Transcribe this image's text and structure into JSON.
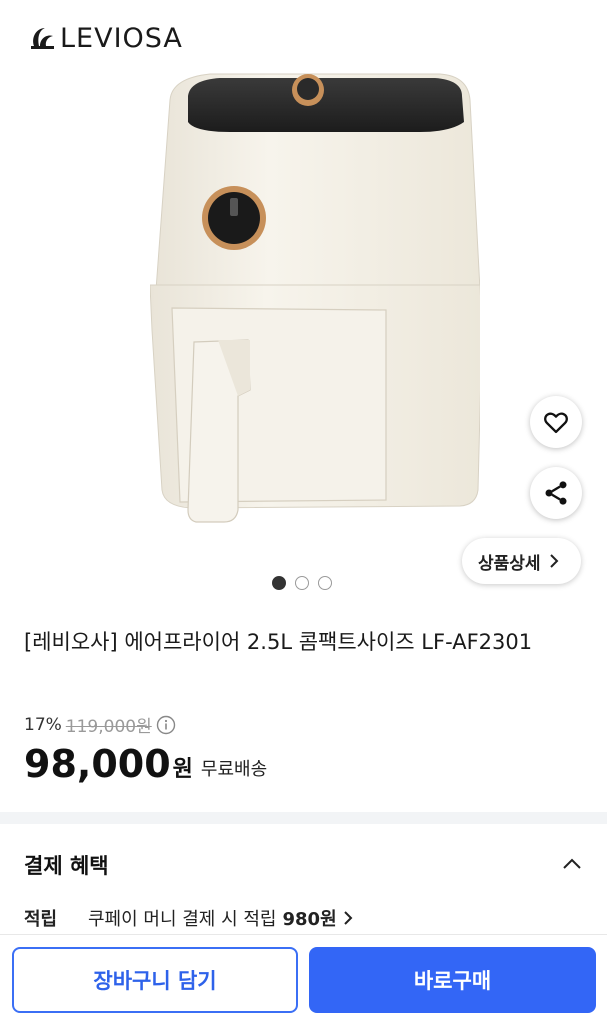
{
  "brand": {
    "name": "LEVIOSA",
    "icon": "leviosa-logo-icon"
  },
  "gallery": {
    "image_alt": "에어프라이어",
    "page_dots": 3,
    "active_dot": 1,
    "detail_button_label": "상품상세",
    "icons": {
      "wishlist": "heart-icon",
      "share": "share-icon",
      "detail": "chevron-right-icon"
    }
  },
  "product": {
    "title": "[레비오사] 에어프라이어 2.5L 콤팩트사이즈 LF-AF2301"
  },
  "price": {
    "discount_rate": "17%",
    "original_price": "119,000원",
    "sale_price": "98,000",
    "currency": "원",
    "shipping": "무료배송",
    "info_icon": "info-icon"
  },
  "benefits": {
    "title": "결제 혜택",
    "toggle_icon": "chevron-up-icon",
    "items": [
      {
        "label": "적립",
        "text": "쿠페이 머니 결제 시 적립",
        "amount": "980원"
      }
    ]
  },
  "actions": {
    "cart_label": "장바구니 담기",
    "buy_label": "바로구매"
  },
  "colors": {
    "accent": "#3366f6",
    "appliance_body": "#f3efe4",
    "appliance_lid": "#2a2a2a",
    "knob_ring": "#c7905a"
  }
}
